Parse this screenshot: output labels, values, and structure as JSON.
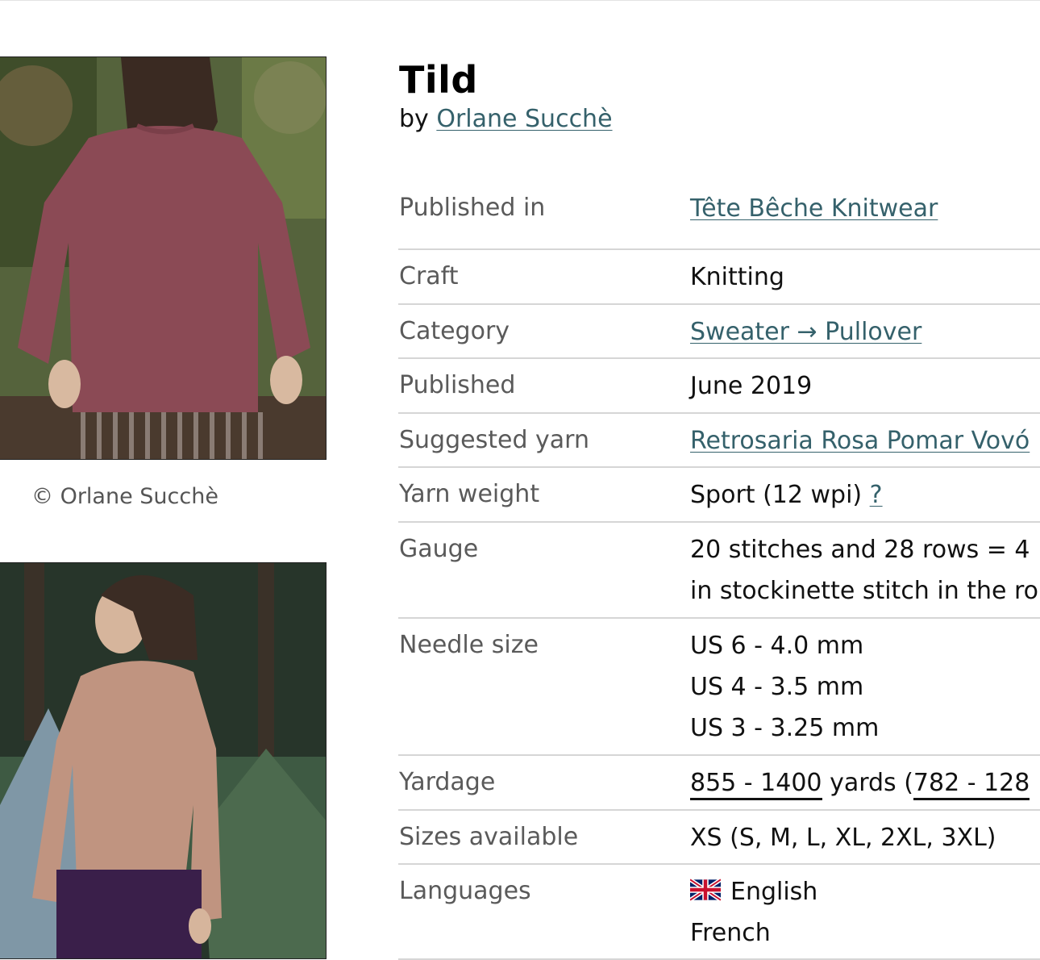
{
  "photos": {
    "caption": "© Orlane Succhè"
  },
  "pattern": {
    "title": "Tild",
    "by_label": "by",
    "author": "Orlane Succhè"
  },
  "details": {
    "published_in": {
      "label": "Published in",
      "value": "Tête Bêche Knitwear"
    },
    "craft": {
      "label": "Craft",
      "value": "Knitting"
    },
    "category": {
      "label": "Category",
      "value": "Sweater → Pullover"
    },
    "published": {
      "label": "Published",
      "value": "June 2019"
    },
    "suggested_yarn": {
      "label": "Suggested yarn",
      "value": "Retrosaria Rosa Pomar Vovó"
    },
    "yarn_weight": {
      "label": "Yarn weight",
      "value": "Sport (12 wpi)",
      "help": "?"
    },
    "gauge": {
      "label": "Gauge",
      "line1": "20 stitches and 28 rows = 4",
      "line2": "in stockinette stitch in the ro"
    },
    "needle_size": {
      "label": "Needle size",
      "sizes": [
        "US 6 - 4.0 mm",
        "US 4 - 3.5 mm",
        "US 3 - 3.25 mm"
      ]
    },
    "yardage": {
      "label": "Yardage",
      "yards_range": "855 - 1400",
      "yards_unit": "yards (",
      "meters_range": "782 - 128"
    },
    "sizes": {
      "label": "Sizes available",
      "value": "XS (S, M, L, XL, 2XL, 3XL)"
    },
    "languages": {
      "label": "Languages",
      "values": [
        "English",
        "French"
      ]
    }
  },
  "colors": {
    "link": "#35616b",
    "label_text": "#5a5a5a",
    "divider": "#d6d6d6"
  },
  "icons": {
    "uk_flag": "flag-uk-icon"
  }
}
